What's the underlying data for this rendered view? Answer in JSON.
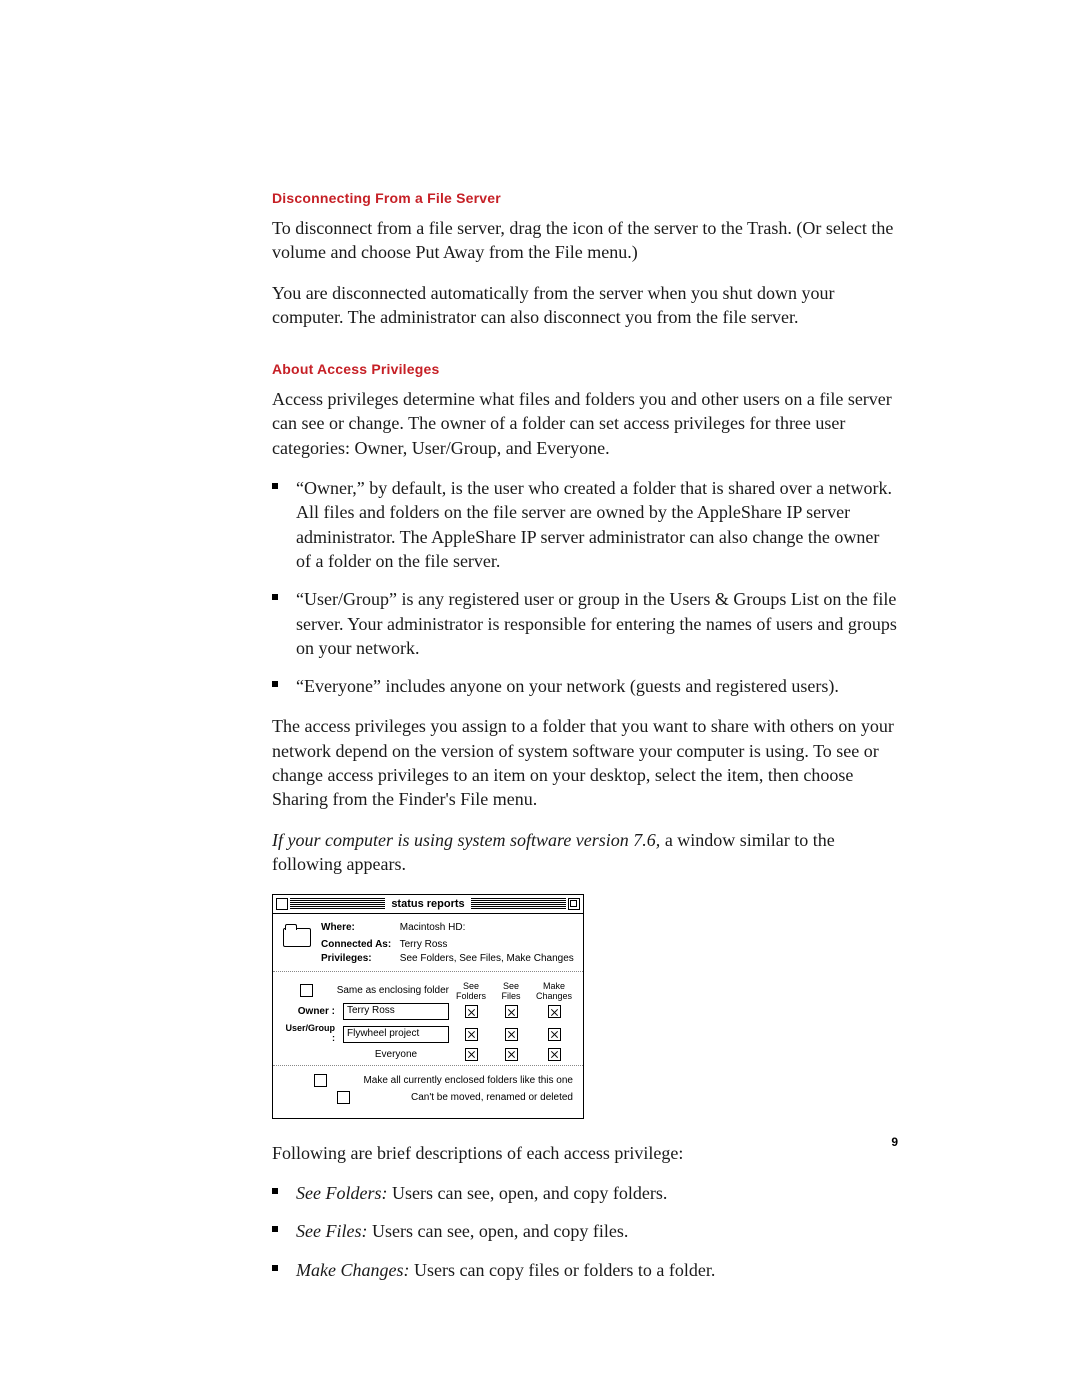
{
  "page_number": "9",
  "section1": {
    "heading": "Disconnecting From a File Server",
    "para1": "To disconnect from a file server, drag the icon of the server to the Trash. (Or select the volume and choose Put Away from the File menu.)",
    "para2": "You are disconnected automatically from the server when you shut down your computer. The administrator can also disconnect you from the file server."
  },
  "section2": {
    "heading": "About Access Privileges",
    "para1": "Access privileges determine what files and folders you and other users on a file server can see or change. The owner of a folder can set access privileges for three user categories: Owner, User/Group, and Everyone.",
    "bullets1": [
      "“Owner,” by default, is the user who created a folder that is shared over a network. All files and folders on the file server are owned by the AppleShare IP server administrator. The AppleShare IP server administrator can also change the owner of a folder on the file server.",
      "“User/Group” is any registered user or group in the Users & Groups List on the file server. Your administrator is responsible for entering the names of users and groups on your network.",
      "“Everyone” includes anyone on your network (guests and registered users)."
    ],
    "para2": "The access privileges you assign to a folder that you want to share with others on your network depend on the version of system software your computer is using. To see or change access privileges to an item on your desktop, select the item, then choose Sharing from the Finder's File menu.",
    "para3_lead_italic": "If your computer is using system software version 7.6,",
    "para3_tail": " a window similar to the following appears.",
    "fig": {
      "title": "status reports",
      "where_label": "Where:",
      "where_value": "Macintosh HD:",
      "conn_label": "Connected As:",
      "conn_value": "Terry Ross",
      "priv_label": "Privileges:",
      "priv_value": "See Folders, See Files, Make Changes",
      "same_as": "Same as enclosing folder",
      "col_see_folders": "See\nFolders",
      "col_see_files": "See\nFiles",
      "col_make_changes": "Make\nChanges",
      "row_owner_label": "Owner :",
      "row_owner_value": "Terry Ross",
      "row_ug_label": "User/Group :",
      "row_ug_value": "Flywheel project",
      "row_everyone": "Everyone",
      "opt1": "Make all currently enclosed folders like this one",
      "opt2": "Can't be moved, renamed or deleted"
    },
    "para_after_fig": "Following are brief descriptions of each access privilege:",
    "bullets2": [
      {
        "term": "See Folders:",
        "desc": "  Users can see, open, and copy folders."
      },
      {
        "term": "See Files:",
        "desc": "  Users can see, open, and copy files."
      },
      {
        "term": "Make Changes:",
        "desc": "  Users can copy files or folders to a folder."
      }
    ]
  }
}
